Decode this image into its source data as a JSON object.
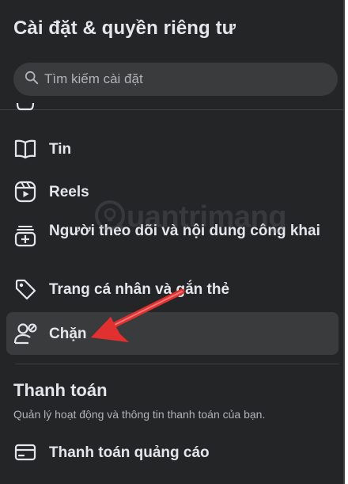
{
  "header": {
    "title": "Cài đặt & quyền riêng tư"
  },
  "search": {
    "placeholder": "Tìm kiếm cài đặt"
  },
  "menu": {
    "items": [
      {
        "label": "",
        "icon": "partial-icon"
      },
      {
        "label": "Tin",
        "icon": "book-icon"
      },
      {
        "label": "Reels",
        "icon": "reels-icon"
      },
      {
        "label": "Người theo dõi và nội dung công khai",
        "icon": "add-followers-icon"
      },
      {
        "label": "Trang cá nhân và gắn thẻ",
        "icon": "tag-icon"
      },
      {
        "label": "Chặn",
        "icon": "block-user-icon"
      }
    ]
  },
  "payments": {
    "title": "Thanh toán",
    "description": "Quản lý hoạt động và thông tin thanh toán của bạn.",
    "items": [
      {
        "label": "Thanh toán quảng cáo",
        "icon": "credit-card-icon"
      }
    ]
  },
  "watermark": {
    "text": "uantrimang"
  },
  "colors": {
    "panel_bg": "#242526",
    "hover_bg": "#3a3b3c",
    "text_primary": "#e4e6eb",
    "text_secondary": "#b0b3b8",
    "annotation_arrow": "#e03030"
  }
}
